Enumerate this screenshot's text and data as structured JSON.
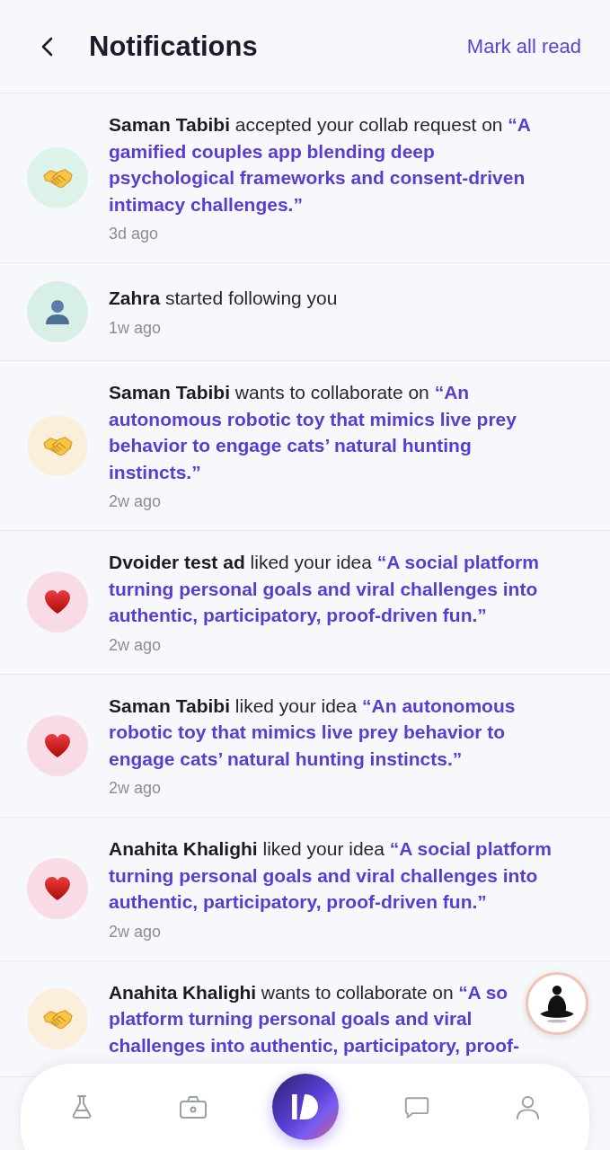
{
  "header": {
    "title": "Notifications",
    "action": "Mark all read"
  },
  "notifications": [
    {
      "kind": "collab_accepted",
      "actor": "Saman Tabibi",
      "action": "accepted your collab request on",
      "idea": "“A gamified couples app blending deep psychological frameworks and consent-driven intimacy challenges.”",
      "time": "3d ago"
    },
    {
      "kind": "follow",
      "actor": "Zahra",
      "action": "started following you",
      "time": "1w ago"
    },
    {
      "kind": "collab_request",
      "actor": "Saman Tabibi",
      "action": "wants to collaborate on",
      "idea": "“An autonomous robotic toy that mimics live prey behavior to engage cats’ natural hunting instincts.”",
      "time": "2w ago"
    },
    {
      "kind": "like",
      "actor": "Dvoider test ad",
      "action": "liked your idea",
      "idea": "“A social platform turning personal goals and viral challenges into authentic, participatory, proof-driven fun.”",
      "time": "2w ago"
    },
    {
      "kind": "like",
      "actor": "Saman Tabibi",
      "action": "liked your idea",
      "idea": "“An autonomous robotic toy that mimics live prey behavior to engage cats’ natural hunting instincts.”",
      "time": "2w ago"
    },
    {
      "kind": "like",
      "actor": "Anahita Khalighi",
      "action": "liked your idea",
      "idea": "“A social platform turning personal goals and viral challenges into authentic, participatory, proof-driven fun.”",
      "time": "2w ago"
    },
    {
      "kind": "collab_request",
      "actor": "Anahita Khalighi",
      "action": "wants to collaborate on",
      "idea": "“A so platform turning personal goals and viral challenges into authentic, participatory, proof-"
    }
  ]
}
